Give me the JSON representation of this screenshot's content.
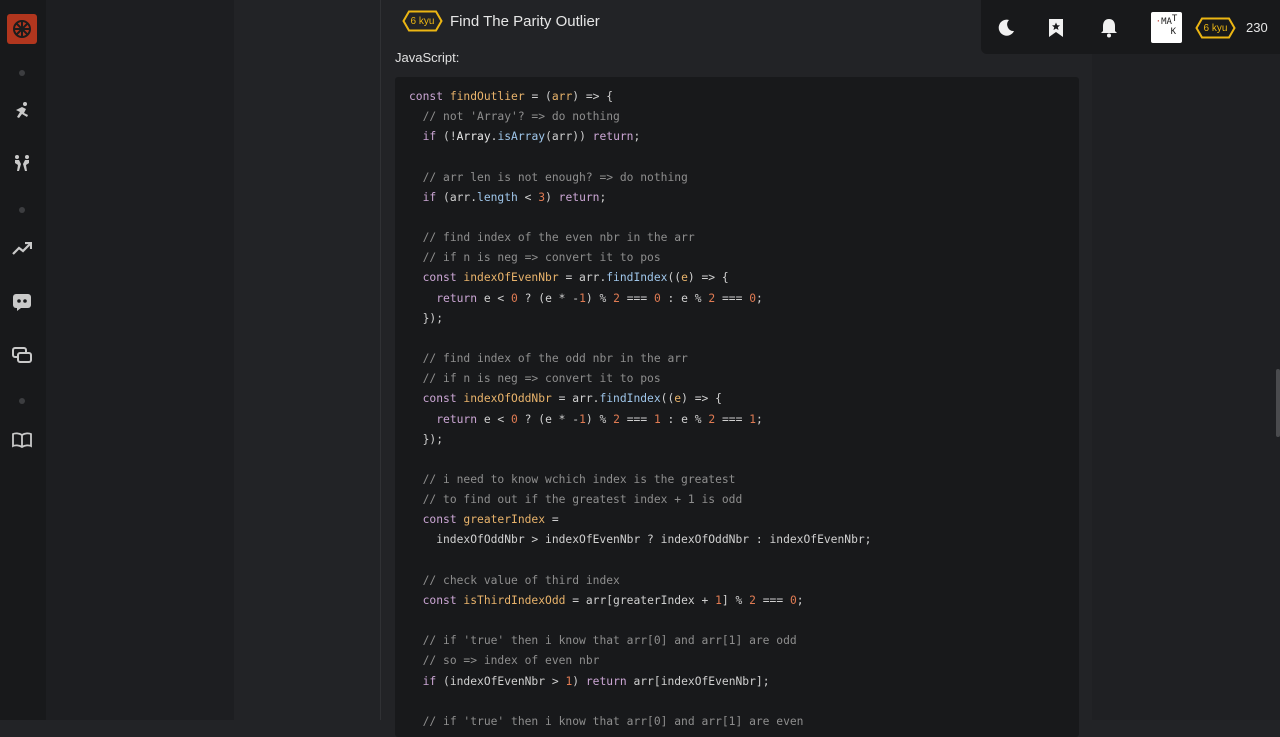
{
  "kata": {
    "rank": "6 kyu",
    "title": "Find The Parity Outlier",
    "language_label": "JavaScript:"
  },
  "user": {
    "avatar_text": [
      "MA",
      "T",
      "K"
    ],
    "rank": "6 kyu",
    "honor": "230"
  },
  "colors": {
    "accent_rank": "#ecb613",
    "logo_bg": "#b1361e",
    "code_bg": "#18191b"
  },
  "sidebar_icons": [
    "logo-icon",
    "practice-icon",
    "training-icon",
    "leaderboards-icon",
    "discord-icon",
    "forum-icon",
    "docs-icon"
  ],
  "topbar_icons": [
    "moon-icon",
    "bookmark-icon",
    "bell-icon"
  ],
  "code_lines": [
    [
      [
        "kw",
        "const "
      ],
      [
        "fn",
        "findOutlier"
      ],
      [
        "op",
        " = ("
      ],
      [
        "fn",
        "arr"
      ],
      [
        "op",
        ") => {"
      ]
    ],
    [
      [
        "op",
        "  "
      ],
      [
        "cm",
        "// not 'Array'? => do nothing"
      ]
    ],
    [
      [
        "op",
        "  "
      ],
      [
        "kw",
        "if"
      ],
      [
        "op",
        " (!"
      ],
      [
        "bi",
        "Array"
      ],
      [
        "op",
        "."
      ],
      [
        "id",
        "isArray"
      ],
      [
        "op",
        "(arr)) "
      ],
      [
        "kw",
        "return"
      ],
      [
        "op",
        ";"
      ]
    ],
    [],
    [
      [
        "op",
        "  "
      ],
      [
        "cm",
        "// arr len is not enough? => do nothing"
      ]
    ],
    [
      [
        "op",
        "  "
      ],
      [
        "kw",
        "if"
      ],
      [
        "op",
        " (arr."
      ],
      [
        "id",
        "length"
      ],
      [
        "op",
        " < "
      ],
      [
        "num",
        "3"
      ],
      [
        "op",
        ") "
      ],
      [
        "kw",
        "return"
      ],
      [
        "op",
        ";"
      ]
    ],
    [],
    [
      [
        "op",
        "  "
      ],
      [
        "cm",
        "// find index of the even nbr in the arr"
      ]
    ],
    [
      [
        "op",
        "  "
      ],
      [
        "cm",
        "// if n is neg => convert it to pos"
      ]
    ],
    [
      [
        "op",
        "  "
      ],
      [
        "kw",
        "const "
      ],
      [
        "fn",
        "indexOfEvenNbr"
      ],
      [
        "op",
        " = arr."
      ],
      [
        "id",
        "findIndex"
      ],
      [
        "op",
        "(("
      ],
      [
        "fn",
        "e"
      ],
      [
        "op",
        ") => {"
      ]
    ],
    [
      [
        "op",
        "    "
      ],
      [
        "kw",
        "return"
      ],
      [
        "op",
        " e < "
      ],
      [
        "num",
        "0"
      ],
      [
        "op",
        " ? (e * -"
      ],
      [
        "num",
        "1"
      ],
      [
        "op",
        ") % "
      ],
      [
        "num",
        "2"
      ],
      [
        "op",
        " === "
      ],
      [
        "num",
        "0"
      ],
      [
        "op",
        " : e % "
      ],
      [
        "num",
        "2"
      ],
      [
        "op",
        " === "
      ],
      [
        "num",
        "0"
      ],
      [
        "op",
        ";"
      ]
    ],
    [
      [
        "op",
        "  });"
      ]
    ],
    [],
    [
      [
        "op",
        "  "
      ],
      [
        "cm",
        "// find index of the odd nbr in the arr"
      ]
    ],
    [
      [
        "op",
        "  "
      ],
      [
        "cm",
        "// if n is neg => convert it to pos"
      ]
    ],
    [
      [
        "op",
        "  "
      ],
      [
        "kw",
        "const "
      ],
      [
        "fn",
        "indexOfOddNbr"
      ],
      [
        "op",
        " = arr."
      ],
      [
        "id",
        "findIndex"
      ],
      [
        "op",
        "(("
      ],
      [
        "fn",
        "e"
      ],
      [
        "op",
        ") => {"
      ]
    ],
    [
      [
        "op",
        "    "
      ],
      [
        "kw",
        "return"
      ],
      [
        "op",
        " e < "
      ],
      [
        "num",
        "0"
      ],
      [
        "op",
        " ? (e * -"
      ],
      [
        "num",
        "1"
      ],
      [
        "op",
        ") % "
      ],
      [
        "num",
        "2"
      ],
      [
        "op",
        " === "
      ],
      [
        "num",
        "1"
      ],
      [
        "op",
        " : e % "
      ],
      [
        "num",
        "2"
      ],
      [
        "op",
        " === "
      ],
      [
        "num",
        "1"
      ],
      [
        "op",
        ";"
      ]
    ],
    [
      [
        "op",
        "  });"
      ]
    ],
    [],
    [
      [
        "op",
        "  "
      ],
      [
        "cm",
        "// i need to know wchich index is the greatest"
      ]
    ],
    [
      [
        "op",
        "  "
      ],
      [
        "cm",
        "// to find out if the greatest index + 1 is odd"
      ]
    ],
    [
      [
        "op",
        "  "
      ],
      [
        "kw",
        "const "
      ],
      [
        "fn",
        "greaterIndex"
      ],
      [
        "op",
        " ="
      ]
    ],
    [
      [
        "op",
        "    indexOfOddNbr > indexOfEvenNbr ? indexOfOddNbr : indexOfEvenNbr;"
      ]
    ],
    [],
    [
      [
        "op",
        "  "
      ],
      [
        "cm",
        "// check value of third index"
      ]
    ],
    [
      [
        "op",
        "  "
      ],
      [
        "kw",
        "const "
      ],
      [
        "fn",
        "isThirdIndexOdd"
      ],
      [
        "op",
        " = arr[greaterIndex + "
      ],
      [
        "num",
        "1"
      ],
      [
        "op",
        "] % "
      ],
      [
        "num",
        "2"
      ],
      [
        "op",
        " === "
      ],
      [
        "num",
        "0"
      ],
      [
        "op",
        ";"
      ]
    ],
    [],
    [
      [
        "op",
        "  "
      ],
      [
        "cm",
        "// if 'true' then i know that arr[0] and arr[1] are odd"
      ]
    ],
    [
      [
        "op",
        "  "
      ],
      [
        "cm",
        "// so => index of even nbr"
      ]
    ],
    [
      [
        "op",
        "  "
      ],
      [
        "kw",
        "if"
      ],
      [
        "op",
        " (indexOfEvenNbr > "
      ],
      [
        "num",
        "1"
      ],
      [
        "op",
        ") "
      ],
      [
        "kw",
        "return"
      ],
      [
        "op",
        " arr[indexOfEvenNbr];"
      ]
    ],
    [],
    [
      [
        "op",
        "  "
      ],
      [
        "cm",
        "// if 'true' then i know that arr[0] and arr[1] are even"
      ]
    ]
  ]
}
